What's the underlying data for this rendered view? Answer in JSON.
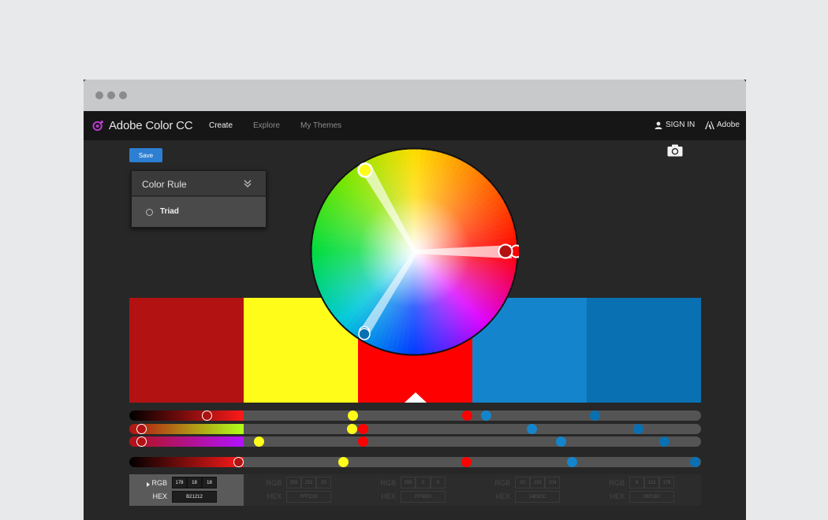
{
  "app": {
    "brand": "Adobe Color CC",
    "nav": [
      "Create",
      "Explore",
      "My Themes"
    ],
    "sign_in": "SIGN IN",
    "adobe": "Adobe"
  },
  "toolbar": {
    "save_label": "Save"
  },
  "color_rule": {
    "title": "Color Rule",
    "selected": "Triad"
  },
  "swatches": [
    {
      "color": "#b21212",
      "rgb": [
        "178",
        "18",
        "18"
      ],
      "hex": "B21212"
    },
    {
      "color": "#fffc19",
      "rgb": [
        "255",
        "252",
        "25"
      ],
      "hex": "FFFC19"
    },
    {
      "color": "#ff0000",
      "rgb": [
        "255",
        "0",
        "0"
      ],
      "hex": "FF0000"
    },
    {
      "color": "#1485cc",
      "rgb": [
        "20",
        "133",
        "204"
      ],
      "hex": "1485CC"
    },
    {
      "color": "#0971b2",
      "rgb": [
        "9",
        "113",
        "178"
      ],
      "hex": "0971B2"
    }
  ],
  "active_swatch_index": 0,
  "labels": {
    "rgb": "RGB",
    "hex": "HEX"
  }
}
